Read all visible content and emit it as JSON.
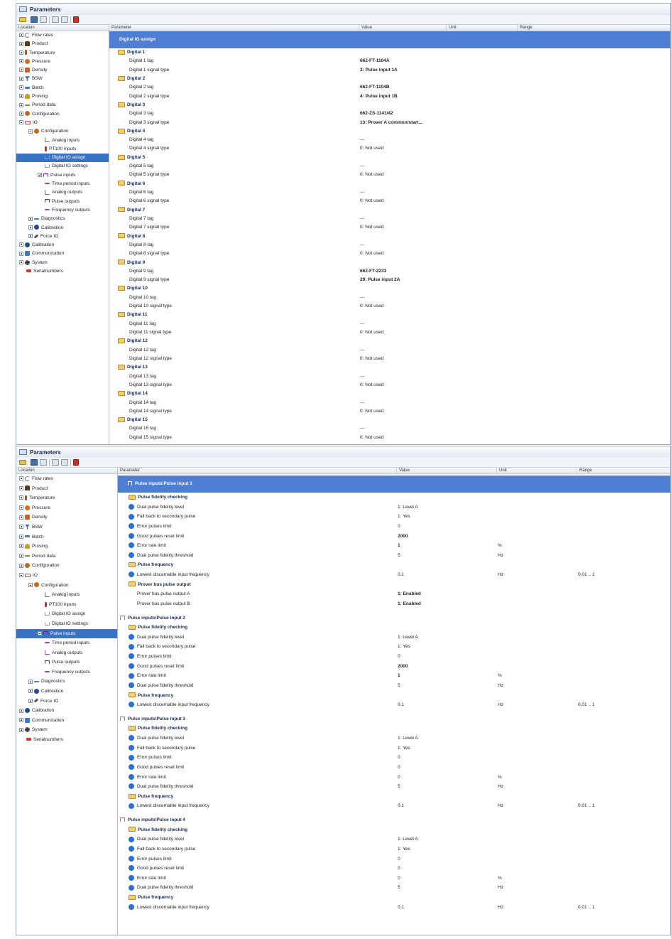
{
  "panel1": {
    "title": "Parameters",
    "columns": {
      "location": "Location",
      "parameter": "Parameter",
      "value": "Value",
      "unit": "Unit",
      "range": "Range"
    },
    "tree": [
      {
        "label": "Flow rates",
        "level": 0,
        "exp": "plus",
        "icon": "flow"
      },
      {
        "label": "Product",
        "level": 0,
        "exp": "plus",
        "icon": "product"
      },
      {
        "label": "Temperature",
        "level": 0,
        "exp": "plus",
        "icon": "temp"
      },
      {
        "label": "Pressure",
        "level": 0,
        "exp": "plus",
        "icon": "pressure"
      },
      {
        "label": "Density",
        "level": 0,
        "exp": "plus",
        "icon": "density"
      },
      {
        "label": "BSW",
        "level": 0,
        "exp": "plus",
        "icon": "bsw"
      },
      {
        "label": "Batch",
        "level": 0,
        "exp": "plus",
        "icon": "batch"
      },
      {
        "label": "Proving",
        "level": 0,
        "exp": "plus",
        "icon": "proving"
      },
      {
        "label": "Period data",
        "level": 0,
        "exp": "plus",
        "icon": "period"
      },
      {
        "label": "Configuration",
        "level": 0,
        "exp": "plus",
        "icon": "config"
      },
      {
        "label": "IO",
        "level": 0,
        "exp": "minus",
        "icon": "io"
      },
      {
        "label": "Configuration",
        "level": 1,
        "exp": "minus",
        "icon": "config"
      },
      {
        "label": "Analog inputs",
        "level": 2,
        "exp": "",
        "icon": "analog"
      },
      {
        "label": "PT100 inputs",
        "level": 2,
        "exp": "",
        "icon": "pt100"
      },
      {
        "label": "Digital IO assign",
        "level": 2,
        "exp": "",
        "icon": "digital",
        "selected": true
      },
      {
        "label": "Digital IO settings",
        "level": 2,
        "exp": "",
        "icon": "digital"
      },
      {
        "label": "Pulse inputs",
        "level": 2,
        "exp": "plus",
        "icon": "pulse"
      },
      {
        "label": "Time period inputs",
        "level": 2,
        "exp": "",
        "icon": "time"
      },
      {
        "label": "Analog outputs",
        "level": 2,
        "exp": "",
        "icon": "analog"
      },
      {
        "label": "Pulse outputs",
        "level": 2,
        "exp": "",
        "icon": "pulse"
      },
      {
        "label": "Frequency outputs",
        "level": 2,
        "exp": "",
        "icon": "time"
      },
      {
        "label": "Diagnostics",
        "level": 1,
        "exp": "plus",
        "icon": "diag"
      },
      {
        "label": "Calibration",
        "level": 1,
        "exp": "plus",
        "icon": "calib"
      },
      {
        "label": "Force IO",
        "level": 1,
        "exp": "plus",
        "icon": "force"
      },
      {
        "label": "Calibration",
        "level": 0,
        "exp": "plus",
        "icon": "calib"
      },
      {
        "label": "Communication",
        "level": 0,
        "exp": "plus",
        "icon": "comm"
      },
      {
        "label": "System",
        "level": 0,
        "exp": "plus",
        "icon": "system"
      },
      {
        "label": "Serialnumbers",
        "level": 0,
        "exp": "",
        "icon": "serial"
      }
    ],
    "header": "Digital IO assign",
    "rows": [
      {
        "t": "grp",
        "label": "Digital 1"
      },
      {
        "t": "par",
        "label": "Digital 1 tag",
        "value": "662-FT-1104A",
        "bold": true
      },
      {
        "t": "par",
        "label": "Digital 1 signal type",
        "value": "3: Pulse input 1A",
        "bold": true
      },
      {
        "t": "grp",
        "label": "Digital 2"
      },
      {
        "t": "par",
        "label": "Digital 2 tag",
        "value": "662-FT-1104B",
        "bold": true
      },
      {
        "t": "par",
        "label": "Digital 2 signal type",
        "value": "4: Pulse input 1B",
        "bold": true
      },
      {
        "t": "grp",
        "label": "Digital 3"
      },
      {
        "t": "par",
        "label": "Digital 3 tag",
        "value": "662-ZS-1141/42",
        "bold": true
      },
      {
        "t": "par",
        "label": "Digital 3 signal type",
        "value": "13: Prover A common/start...",
        "bold": true
      },
      {
        "t": "grp",
        "label": "Digital 4"
      },
      {
        "t": "par",
        "label": "Digital 4 tag",
        "value": "---"
      },
      {
        "t": "par",
        "label": "Digital 4 signal type",
        "value": "0: Not used"
      },
      {
        "t": "grp",
        "label": "Digital 5"
      },
      {
        "t": "par",
        "label": "Digital 5 tag",
        "value": "---"
      },
      {
        "t": "par",
        "label": "Digital 5 signal type",
        "value": "0: Not used"
      },
      {
        "t": "grp",
        "label": "Digital 6"
      },
      {
        "t": "par",
        "label": "Digital 6 tag",
        "value": "---"
      },
      {
        "t": "par",
        "label": "Digital 6 signal type",
        "value": "0: Not used"
      },
      {
        "t": "grp",
        "label": "Digital 7"
      },
      {
        "t": "par",
        "label": "Digital 7 tag",
        "value": "---"
      },
      {
        "t": "par",
        "label": "Digital 7 signal type",
        "value": "0: Not used"
      },
      {
        "t": "grp",
        "label": "Digital 8"
      },
      {
        "t": "par",
        "label": "Digital 8 tag",
        "value": "---"
      },
      {
        "t": "par",
        "label": "Digital 8 signal type",
        "value": "0: Not used"
      },
      {
        "t": "grp",
        "label": "Digital 9"
      },
      {
        "t": "par",
        "label": "Digital 9 tag",
        "value": "662-FT-2233",
        "bold": true
      },
      {
        "t": "par",
        "label": "Digital 9 signal type",
        "value": "29: Pulse input 2A",
        "bold": true
      },
      {
        "t": "grp",
        "label": "Digital 10"
      },
      {
        "t": "par",
        "label": "Digital 10 tag",
        "value": "---"
      },
      {
        "t": "par",
        "label": "Digital 10 signal type",
        "value": "0: Not used"
      },
      {
        "t": "grp",
        "label": "Digital 11"
      },
      {
        "t": "par",
        "label": "Digital 11 tag",
        "value": "---"
      },
      {
        "t": "par",
        "label": "Digital 11 signal type",
        "value": "0: Not used"
      },
      {
        "t": "grp",
        "label": "Digital 12"
      },
      {
        "t": "par",
        "label": "Digital 12 tag",
        "value": "---"
      },
      {
        "t": "par",
        "label": "Digital 12 signal type",
        "value": "0: Not used"
      },
      {
        "t": "grp",
        "label": "Digital 13"
      },
      {
        "t": "par",
        "label": "Digital 13 tag",
        "value": "---"
      },
      {
        "t": "par",
        "label": "Digital 13 signal type",
        "value": "0: Not used"
      },
      {
        "t": "grp",
        "label": "Digital 14"
      },
      {
        "t": "par",
        "label": "Digital 14 tag",
        "value": "---"
      },
      {
        "t": "par",
        "label": "Digital 14 signal type",
        "value": "0: Not used"
      },
      {
        "t": "grp",
        "label": "Digital 15"
      },
      {
        "t": "par",
        "label": "Digital 15 tag",
        "value": "---"
      },
      {
        "t": "par",
        "label": "Digital 15 signal type",
        "value": "0: Not used"
      }
    ]
  },
  "panel2": {
    "title": "Parameters",
    "columns": {
      "location": "Location",
      "parameter": "Parameter",
      "value": "Value",
      "unit": "Unit",
      "range": "Range"
    },
    "tree": [
      {
        "label": "Flow rates",
        "level": 0,
        "exp": "plus",
        "icon": "flow"
      },
      {
        "label": "Product",
        "level": 0,
        "exp": "plus",
        "icon": "product"
      },
      {
        "label": "Temperature",
        "level": 0,
        "exp": "plus",
        "icon": "temp"
      },
      {
        "label": "Pressure",
        "level": 0,
        "exp": "plus",
        "icon": "pressure"
      },
      {
        "label": "Density",
        "level": 0,
        "exp": "plus",
        "icon": "density"
      },
      {
        "label": "BSW",
        "level": 0,
        "exp": "plus",
        "icon": "bsw"
      },
      {
        "label": "Batch",
        "level": 0,
        "exp": "plus",
        "icon": "batch"
      },
      {
        "label": "Proving",
        "level": 0,
        "exp": "plus",
        "icon": "proving"
      },
      {
        "label": "Period data",
        "level": 0,
        "exp": "plus",
        "icon": "period"
      },
      {
        "label": "Configuration",
        "level": 0,
        "exp": "plus",
        "icon": "config"
      },
      {
        "label": "IO",
        "level": 0,
        "exp": "minus",
        "icon": "io"
      },
      {
        "label": "Configuration",
        "level": 1,
        "exp": "minus",
        "icon": "config"
      },
      {
        "label": "Analog inputs",
        "level": 2,
        "exp": "",
        "icon": "analog"
      },
      {
        "label": "PT100 inputs",
        "level": 2,
        "exp": "",
        "icon": "pt100"
      },
      {
        "label": "Digital IO assign",
        "level": 2,
        "exp": "",
        "icon": "digital"
      },
      {
        "label": "Digital IO settings",
        "level": 2,
        "exp": "",
        "icon": "digital"
      },
      {
        "label": "Pulse inputs",
        "level": 2,
        "exp": "plus",
        "icon": "pulse",
        "selected": true
      },
      {
        "label": "Time period inputs",
        "level": 2,
        "exp": "",
        "icon": "time"
      },
      {
        "label": "Analog outputs",
        "level": 2,
        "exp": "",
        "icon": "analog"
      },
      {
        "label": "Pulse outputs",
        "level": 2,
        "exp": "",
        "icon": "pulse"
      },
      {
        "label": "Frequency outputs",
        "level": 2,
        "exp": "",
        "icon": "time"
      },
      {
        "label": "Diagnostics",
        "level": 1,
        "exp": "plus",
        "icon": "diag"
      },
      {
        "label": "Calibration",
        "level": 1,
        "exp": "plus",
        "icon": "calib"
      },
      {
        "label": "Force IO",
        "level": 1,
        "exp": "plus",
        "icon": "force"
      },
      {
        "label": "Calibration",
        "level": 0,
        "exp": "plus",
        "icon": "calib"
      },
      {
        "label": "Communication",
        "level": 0,
        "exp": "plus",
        "icon": "comm"
      },
      {
        "label": "System",
        "level": 0,
        "exp": "plus",
        "icon": "system"
      },
      {
        "label": "Serialnumbers",
        "level": 0,
        "exp": "",
        "icon": "serial"
      }
    ],
    "header": "Pulse inputs\\Pulse input 1",
    "rows": [
      {
        "t": "grp",
        "label": "Pulse fidelity checking"
      },
      {
        "t": "par",
        "info": true,
        "label": "Dual pulse fidelity level",
        "value": "1: Level A"
      },
      {
        "t": "par",
        "info": true,
        "label": "Fall back to secondary pulse",
        "value": "1: Yes"
      },
      {
        "t": "par",
        "info": true,
        "label": "Error pulses limit",
        "value": "0"
      },
      {
        "t": "par",
        "info": true,
        "label": "Good pulses reset limit",
        "value": "2000",
        "bold": true
      },
      {
        "t": "par",
        "info": true,
        "label": "Error rate limit",
        "value": "1",
        "bold": true,
        "unit": "%"
      },
      {
        "t": "par",
        "info": true,
        "label": "Dual pulse fidelity threshold",
        "value": "5",
        "unit": "Hz"
      },
      {
        "t": "grp",
        "label": "Pulse frequency"
      },
      {
        "t": "par",
        "info": true,
        "label": "Lowest discernable input frequency",
        "value": "0.1",
        "unit": "Hz",
        "range": "0.01 .. 1"
      },
      {
        "t": "grp",
        "label": "Prover bus pulse output"
      },
      {
        "t": "par",
        "info": false,
        "label": "Prover bus pulse output A",
        "value": "1: Enabled",
        "bold": true
      },
      {
        "t": "par",
        "info": false,
        "label": "Prover bus pulse output B",
        "value": "1: Enabled",
        "bold": true
      },
      {
        "t": "sect",
        "label": "Pulse inputs\\Pulse input 2"
      },
      {
        "t": "grp",
        "label": "Pulse fidelity checking"
      },
      {
        "t": "par",
        "info": true,
        "label": "Dual pulse fidelity level",
        "value": "1: Level A"
      },
      {
        "t": "par",
        "info": true,
        "label": "Fall back to secondary pulse",
        "value": "1: Yes"
      },
      {
        "t": "par",
        "info": true,
        "label": "Error pulses limit",
        "value": "0"
      },
      {
        "t": "par",
        "info": true,
        "label": "Good pulses reset limit",
        "value": "2000",
        "bold": true
      },
      {
        "t": "par",
        "info": true,
        "label": "Error rate limit",
        "value": "1",
        "bold": true,
        "unit": "%"
      },
      {
        "t": "par",
        "info": true,
        "label": "Dual pulse fidelity threshold",
        "value": "5",
        "unit": "Hz"
      },
      {
        "t": "grp",
        "label": "Pulse frequency"
      },
      {
        "t": "par",
        "info": true,
        "label": "Lowest discernable input frequency",
        "value": "0.1",
        "unit": "Hz",
        "range": "0.01 .. 1"
      },
      {
        "t": "sect",
        "label": "Pulse inputs\\Pulse input 3"
      },
      {
        "t": "grp",
        "label": "Pulse fidelity checking"
      },
      {
        "t": "par",
        "info": true,
        "label": "Dual pulse fidelity level",
        "value": "1: Level A"
      },
      {
        "t": "par",
        "info": true,
        "label": "Fall back to secondary pulse",
        "value": "1: Yes"
      },
      {
        "t": "par",
        "info": true,
        "label": "Error pulses limit",
        "value": "0"
      },
      {
        "t": "par",
        "info": true,
        "label": "Good pulses reset limit",
        "value": "0"
      },
      {
        "t": "par",
        "info": true,
        "label": "Error rate limit",
        "value": "0",
        "unit": "%"
      },
      {
        "t": "par",
        "info": true,
        "label": "Dual pulse fidelity threshold",
        "value": "5",
        "unit": "Hz"
      },
      {
        "t": "grp",
        "label": "Pulse frequency"
      },
      {
        "t": "par",
        "info": true,
        "label": "Lowest discernable input frequency",
        "value": "0.1",
        "unit": "Hz",
        "range": "0.01 .. 1"
      },
      {
        "t": "sect",
        "label": "Pulse inputs\\Pulse input 4"
      },
      {
        "t": "grp",
        "label": "Pulse fidelity checking"
      },
      {
        "t": "par",
        "info": true,
        "label": "Dual pulse fidelity level",
        "value": "1: Level A"
      },
      {
        "t": "par",
        "info": true,
        "label": "Fall back to secondary pulse",
        "value": "1: Yes"
      },
      {
        "t": "par",
        "info": true,
        "label": "Error pulses limit",
        "value": "0"
      },
      {
        "t": "par",
        "info": true,
        "label": "Good pulses reset limit",
        "value": "0"
      },
      {
        "t": "par",
        "info": true,
        "label": "Error rate limit",
        "value": "0",
        "unit": "%"
      },
      {
        "t": "par",
        "info": true,
        "label": "Dual pulse fidelity threshold",
        "value": "5",
        "unit": "Hz"
      },
      {
        "t": "grp",
        "label": "Pulse frequency"
      },
      {
        "t": "par",
        "info": true,
        "label": "Lowest discernable input frequency",
        "value": "0.1",
        "unit": "Hz",
        "range": "0.01 .. 1"
      }
    ]
  }
}
